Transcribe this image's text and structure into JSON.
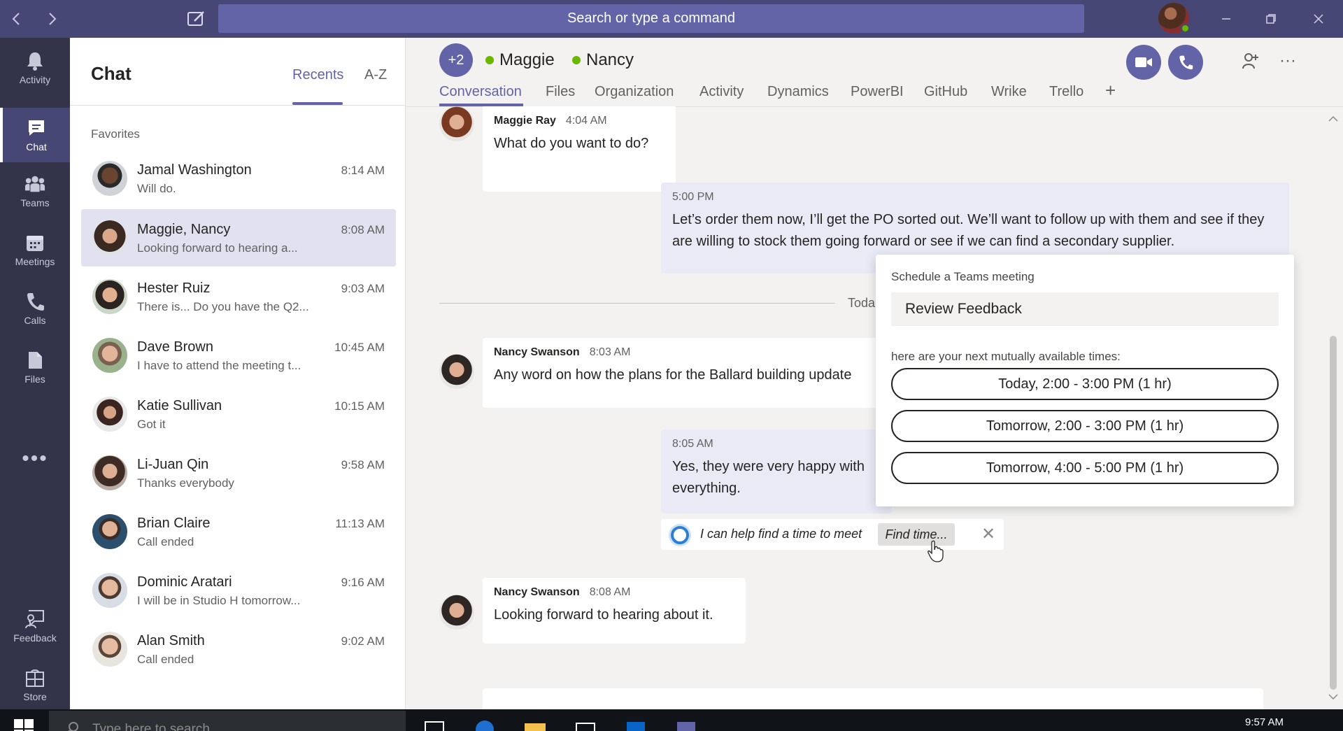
{
  "titlebar": {
    "search_placeholder": "Search or type a command",
    "icons": [
      "back-icon",
      "forward-icon",
      "compose-icon",
      "minimize-icon",
      "restore-icon",
      "close-icon"
    ]
  },
  "rail": {
    "items": [
      {
        "label": "Activity",
        "icon": "bell-icon"
      },
      {
        "label": "Chat",
        "icon": "chat-icon"
      },
      {
        "label": "Teams",
        "icon": "teams-icon"
      },
      {
        "label": "Meetings",
        "icon": "calendar-icon"
      },
      {
        "label": "Calls",
        "icon": "phone-icon"
      },
      {
        "label": "Files",
        "icon": "file-icon"
      }
    ],
    "more": "•••",
    "bottom": [
      {
        "label": "Feedback",
        "icon": "feedback-icon"
      },
      {
        "label": "Store",
        "icon": "store-icon"
      }
    ]
  },
  "chatlist": {
    "title": "Chat",
    "tabs": [
      "Recents",
      "A-Z"
    ],
    "section": "Favorites",
    "chats": [
      {
        "name": "Jamal Washington",
        "preview": "Will do.",
        "time": "8:14 AM"
      },
      {
        "name": "Maggie, Nancy",
        "preview": "Looking forward to hearing a...",
        "time": "8:08 AM"
      },
      {
        "name": "Hester Ruiz",
        "preview": "There is... Do you have the Q2...",
        "time": "9:03 AM"
      },
      {
        "name": "Dave Brown",
        "preview": "I have to attend the meeting t...",
        "time": "10:45 AM"
      },
      {
        "name": "Katie Sullivan",
        "preview": "Got it",
        "time": "10:15 AM"
      },
      {
        "name": "Li-Juan Qin",
        "preview": "Thanks everybody",
        "time": "9:58 AM"
      },
      {
        "name": "Brian Claire",
        "preview": "Call ended",
        "time": "11:13 AM"
      },
      {
        "name": "Dominic Aratari",
        "preview": "I will be in Studio H tomorrow...",
        "time": "9:16 AM"
      },
      {
        "name": "Alan Smith",
        "preview": "Call ended",
        "time": "9:02 AM"
      }
    ]
  },
  "main": {
    "group_badge": "+2",
    "participants": [
      "Maggie",
      "Nancy"
    ],
    "tabs": [
      "Conversation",
      "Files",
      "Organization",
      "Activity",
      "Dynamics",
      "PowerBI",
      "GitHub",
      "Wrike",
      "Trello"
    ],
    "add_tab": "+",
    "more": "···",
    "messages": [
      {
        "sender": "Maggie Ray",
        "time": "4:04 AM",
        "text": "What do you want to do?"
      },
      {
        "sender": "",
        "time": "5:00 PM",
        "text": "Let’s order them now, I’ll get the PO sorted out. We’ll want to follow up with them and see if they are willing to stock them going forward or see if we can find a secondary supplier."
      },
      {
        "sender": "Nancy Swanson",
        "time": "8:03 AM",
        "text": "Any word on how the plans for the Ballard building update"
      },
      {
        "sender": "",
        "time": "8:05 AM",
        "text": "Yes, they were very happy with everything."
      },
      {
        "sender": "Nancy Swanson",
        "time": "8:08 AM",
        "text": "Looking forward to hearing about it."
      }
    ],
    "today_label": "Toda",
    "bot": {
      "text": "I can help find a time to meet",
      "button": "Find time...",
      "close": "✕"
    }
  },
  "popup": {
    "title": "Schedule a Teams meeting",
    "meeting_name": "Review Feedback",
    "subtitle": "here are your next mutually available times:",
    "slots": [
      "Today, 2:00 - 3:00 PM (1 hr)",
      "Tomorrow, 2:00 - 3:00 PM (1 hr)",
      "Tomorrow, 4:00 - 5:00 PM (1 hr)"
    ]
  },
  "taskbar": {
    "search_placeholder": "Type here to search",
    "time": "9:57 AM"
  },
  "colors": {
    "brand": "#6264a7",
    "titlebar": "#464775",
    "rail": "#33344a",
    "presence": "#6bb700"
  }
}
